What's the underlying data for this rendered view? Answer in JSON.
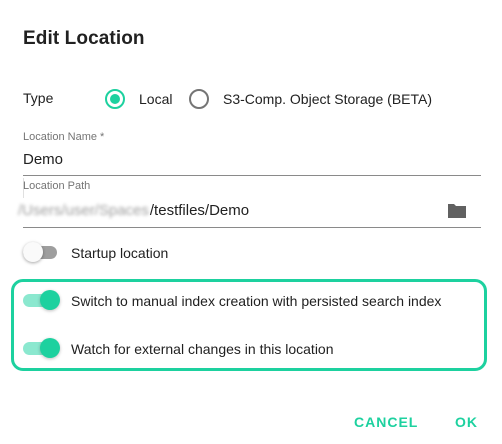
{
  "dialog": {
    "title": "Edit Location"
  },
  "type": {
    "label": "Type",
    "options": [
      {
        "label": "Local",
        "selected": true
      },
      {
        "label": "S3-Comp. Object Storage (BETA)",
        "selected": false
      }
    ]
  },
  "location_name": {
    "label": "Location Name *",
    "value": "Demo"
  },
  "location_path": {
    "label": "Location Path",
    "value_obscured": "/Users/user/Spaces",
    "value": "/testfiles/Demo",
    "button_icon": "folder-icon"
  },
  "switches": [
    {
      "label": "Startup location",
      "checked": false
    },
    {
      "label": "Switch to manual index creation with persisted search index",
      "checked": true
    },
    {
      "label": "Watch for external changes in this location",
      "checked": true
    }
  ],
  "actions": {
    "cancel_label": "CANCEL",
    "ok_label": "OK"
  },
  "colors": {
    "accent": "#1dd19f",
    "accent_light": "#8be8cf",
    "text": "#212121",
    "muted": "#757575",
    "highlight_border": "#1dd19f"
  }
}
